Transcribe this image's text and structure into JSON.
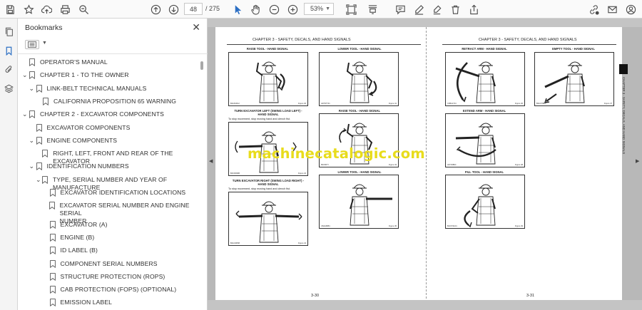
{
  "toolbar": {
    "page_current": "48",
    "page_total": "/ 275",
    "zoom": "53%",
    "icons": [
      "save-icon",
      "bookmark-star-icon",
      "upload-icon",
      "print-icon",
      "search-icon",
      "prev-page-icon",
      "next-page-icon",
      "select-cursor-icon",
      "hand-pan-icon",
      "zoom-out-icon",
      "zoom-in-icon",
      "fit-page-icon",
      "scroll-mode-icon",
      "comment-icon",
      "draw-pen-icon",
      "highlight-icon",
      "delete-icon",
      "share-icon",
      "link-sign-icon",
      "email-icon",
      "account-icon"
    ]
  },
  "rail": {
    "icons": [
      "copy-pages-icon",
      "bookmarks-icon",
      "attachments-icon",
      "layers-icon"
    ]
  },
  "bookmarks": {
    "title": "Bookmarks",
    "items": [
      {
        "label": "OPERATOR'S MANUAL",
        "level": 0,
        "chevron": ""
      },
      {
        "label": "CHAPTER 1 - TO THE OWNER",
        "level": 0,
        "chevron": "⌄"
      },
      {
        "label": "LINK-BELT TECHNICAL MANUALS",
        "level": 1,
        "chevron": "⌄"
      },
      {
        "label": "CALIFORNIA PROPOSITION 65 WARNING",
        "level": 2,
        "chevron": ""
      },
      {
        "label": "CHAPTER 2 - EXCAVATOR COMPONENTS",
        "level": 0,
        "chevron": "⌄"
      },
      {
        "label": "EXCAVATOR COMPONENTS",
        "level": 1,
        "chevron": ""
      },
      {
        "label": "ENGINE COMPONENTS",
        "level": 1,
        "chevron": "⌄"
      },
      {
        "label": "RIGHT, LEFT, FRONT AND REAR OF THE EXCAVATOR",
        "level": 2,
        "chevron": ""
      },
      {
        "label": "IDENTIFICATION NUMBERS",
        "level": 1,
        "chevron": "⌄"
      },
      {
        "label": "TYPE, SERIAL NUMBER AND YEAR OF MANUFACTURE",
        "level": 2,
        "chevron": "⌄"
      },
      {
        "label": "EXCAVATOR IDENTIFICATION LOCATIONS",
        "level": 3,
        "chevron": ""
      },
      {
        "label": "EXCAVATOR SERIAL NUMBER AND ENGINE SERIAL",
        "label2": "NUMBER",
        "level": 3,
        "chevron": ""
      },
      {
        "label": "EXCAVATOR (A)",
        "level": 3,
        "chevron": ""
      },
      {
        "label": "ENGINE (B)",
        "level": 3,
        "chevron": ""
      },
      {
        "label": "ID LABEL (B)",
        "level": 3,
        "chevron": ""
      },
      {
        "label": "COMPONENT SERIAL NUMBERS",
        "level": 3,
        "chevron": ""
      },
      {
        "label": "STRUCTURE PROTECTION (ROPS)",
        "level": 3,
        "chevron": ""
      },
      {
        "label": "CAB PROTECTION (FOPS) (OPTIONAL)",
        "level": 3,
        "chevron": ""
      },
      {
        "label": "EMISSION LABEL",
        "level": 3,
        "chevron": ""
      }
    ]
  },
  "document": {
    "left_page": {
      "chapter_header": "CHAPTER 3 - SAFETY, DECALS, AND HAND SIGNALS",
      "page_number": "3-30",
      "figures": [
        {
          "title": "RAISE TOOL - HAND SIGNAL",
          "note": "",
          "code": "B4ASN012",
          "num": "Figure 40"
        },
        {
          "title": "LOWER TOOL - HAND SIGNAL",
          "note": "",
          "code": "A07KPY01",
          "num": "Figure 41"
        },
        {
          "title": "TURN EXCAVATOR LEFT (SWING LOAD LEFT) -",
          "title2": "HAND SIGNAL",
          "note": "To stop movement, stop moving hand and clench fist.",
          "code": "B4CR009B",
          "num": "Figure 42"
        },
        {
          "title": "RAISE TOOL - HAND SIGNAL",
          "note": "",
          "code": "B4C807Y",
          "num": "Figure 43"
        },
        {
          "title": "TURN EXCAVATOR RIGHT (SWING LOAD RIGHT) -",
          "title2": "HAND SIGNAL",
          "note": "To stop movement, stop moving hand and clench fist.",
          "code": "B4ACR058",
          "num": "Figure 44"
        },
        {
          "title": "LOWER TOOL - HAND SIGNAL",
          "note": "",
          "code": "C8AA6884",
          "num": "Figure 45"
        }
      ]
    },
    "right_page": {
      "chapter_header": "CHAPTER 3 - SAFETY, DECALS, AND HAND SIGNALS",
      "page_number": "3-31",
      "side_tab": "CHAPTER 3 - SAFETY, DECALS, AND HAND SIGNALS",
      "figures": [
        {
          "title": "RETRACT ARM - HAND SIGNAL",
          "note": "",
          "code": "C3BA1724",
          "num": "Figure 46"
        },
        {
          "title": "EMPTY TOOL - HAND SIGNAL",
          "note": "",
          "code": "B2AC79BY",
          "num": "Figure 47"
        },
        {
          "title": "EXTEND ARM - HAND SIGNAL",
          "note": "",
          "code": "A07A6B64",
          "num": "Figure 48"
        },
        {
          "title": "FILL TOOL - HAND SIGNAL",
          "note": "",
          "code": "B1C671104",
          "num": "Figure 49"
        }
      ]
    },
    "watermark": "machinecatalogic.com"
  },
  "colors": {
    "accent": "#2c6fc4",
    "watermark": "#e8dc1c",
    "doc_bg": "#b8b8b8"
  }
}
